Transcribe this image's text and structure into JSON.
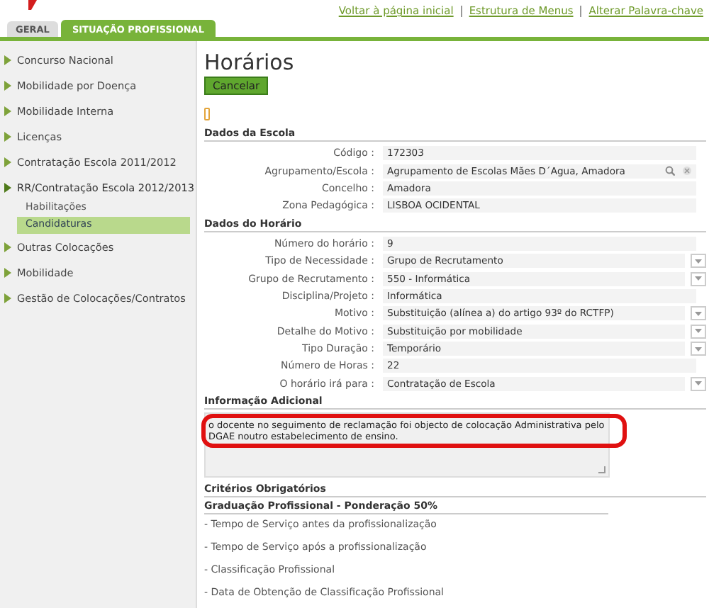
{
  "top_links": [
    "Voltar à página inicial",
    "Estrutura de Menus",
    "Alterar Palavra-chave"
  ],
  "tabs": [
    {
      "label": "GERAL",
      "selected": false
    },
    {
      "label": "SITUAÇÃO PROFISSIONAL",
      "selected": true
    }
  ],
  "sidebar": {
    "items": [
      {
        "label": "Concurso Nacional",
        "expanded": false
      },
      {
        "label": "Mobilidade por Doença",
        "expanded": false
      },
      {
        "label": "Mobilidade Interna",
        "expanded": false
      },
      {
        "label": "Licenças",
        "expanded": false
      },
      {
        "label": "Contratação Escola 2011/2012",
        "expanded": false
      },
      {
        "label": "RR/Contratação Escola 2012/2013",
        "expanded": true,
        "children": [
          {
            "label": "Habilitações",
            "selected": false
          },
          {
            "label": "Candidaturas",
            "selected": true
          }
        ]
      },
      {
        "label": "Outras Colocações",
        "expanded": false
      },
      {
        "label": "Mobilidade",
        "expanded": false
      },
      {
        "label": "Gestão de Colocações/Contratos",
        "expanded": false
      }
    ]
  },
  "page_title": "Horários",
  "cancel_button": "Cancelar",
  "sections": [
    {
      "title": "Dados da Escola",
      "fields": [
        {
          "label": "Código :",
          "value": "172303",
          "kind": "text"
        },
        {
          "label": "Agrupamento/Escola :",
          "value": "Agrupamento de Escolas Mães D´Agua, Amadora",
          "kind": "lookup"
        },
        {
          "label": "Concelho :",
          "value": "Amadora",
          "kind": "text"
        },
        {
          "label": "Zona Pedagógica :",
          "value": "LISBOA OCIDENTAL",
          "kind": "text"
        }
      ]
    },
    {
      "title": "Dados do Horário",
      "fields": [
        {
          "label": "Número do horário :",
          "value": "9",
          "kind": "text"
        },
        {
          "label": "Tipo de Necessidade :",
          "value": "Grupo de Recrutamento",
          "kind": "select"
        },
        {
          "label": "Grupo de Recrutamento :",
          "value": "550 - Informática",
          "kind": "select"
        },
        {
          "label": "Disciplina/Projeto :",
          "value": "Informática",
          "kind": "text"
        },
        {
          "label": "Motivo :",
          "value": "Substituição (alínea a) do artigo 93º do RCTFP)",
          "kind": "select"
        },
        {
          "label": "Detalhe do Motivo :",
          "value": "Substituição por mobilidade",
          "kind": "select"
        },
        {
          "label": "Tipo Duração :",
          "value": "Temporário",
          "kind": "select"
        },
        {
          "label": "Número de Horas :",
          "value": "22",
          "kind": "text"
        },
        {
          "label": "O horário irá para :",
          "value": "Contratação de Escola",
          "kind": "select"
        }
      ]
    }
  ],
  "additional_info": {
    "title": "Informação Adicional",
    "text": "o docente no seguimento de reclamação foi objecto de colocação Administrativa pelo DGAE noutro estabelecimento de ensino."
  },
  "criteria": {
    "title": "Critérios Obrigatórios",
    "subtitle": "Graduação Profissional - Ponderação 50%",
    "items": [
      "- Tempo de Serviço antes da profissionalização",
      "- Tempo de Serviço após a profissionalização",
      "- Classificação Profissional",
      "- Data de Obtenção de Classificação Profissional"
    ]
  }
}
